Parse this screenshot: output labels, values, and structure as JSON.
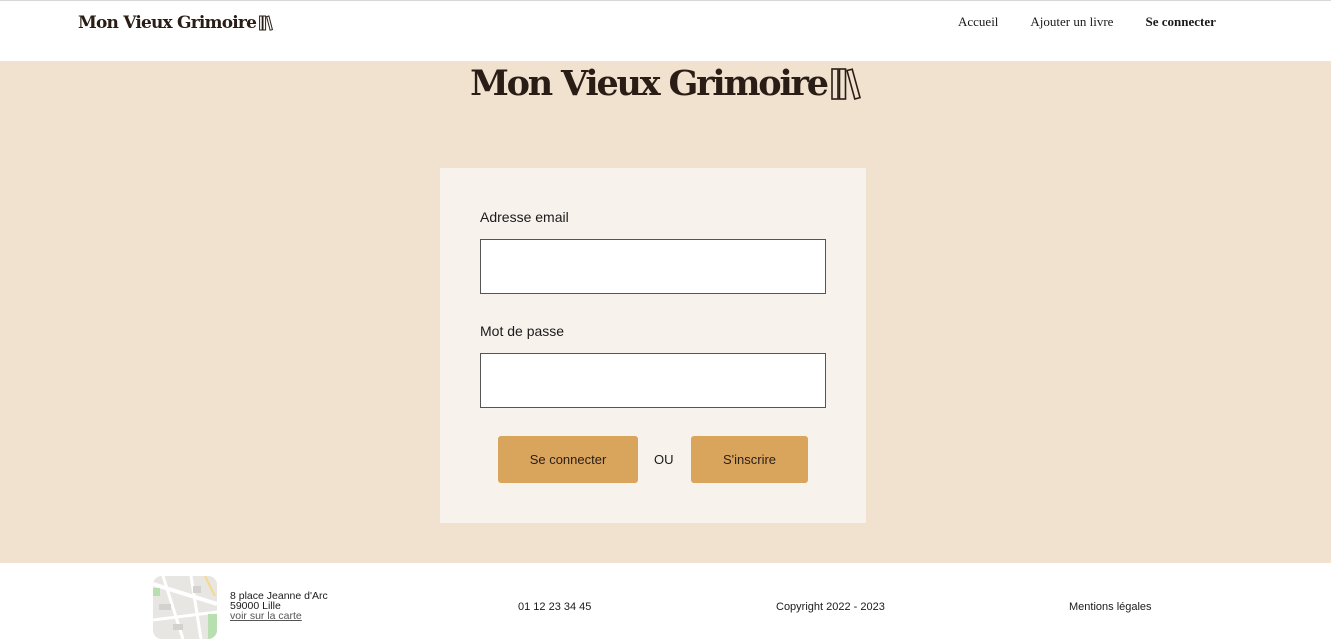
{
  "header": {
    "logo_text": "Mon Vieux Grimoire",
    "nav": [
      {
        "label": "Accueil"
      },
      {
        "label": "Ajouter un livre"
      },
      {
        "label": "Se connecter"
      }
    ]
  },
  "main": {
    "logo_text": "Mon Vieux Grimoire",
    "form": {
      "email_label": "Adresse email",
      "email_value": "",
      "password_label": "Mot de passe",
      "password_value": "",
      "login_button": "Se connecter",
      "separator": "OU",
      "signup_button": "S'inscrire"
    }
  },
  "footer": {
    "address_line1": "8 place Jeanne d'Arc",
    "address_line2": "59000 Lille",
    "map_link": "voir sur la carte",
    "phone": "01 12 23 34 45",
    "copyright": "Copyright 2022 - 2023",
    "legal": "Mentions légales"
  },
  "colors": {
    "accent": "#d9a55d",
    "background": "#f0e2ce",
    "card": "#f7f2ec",
    "text_dark": "#2a1d16"
  },
  "icons": {
    "logo": "books-icon"
  }
}
